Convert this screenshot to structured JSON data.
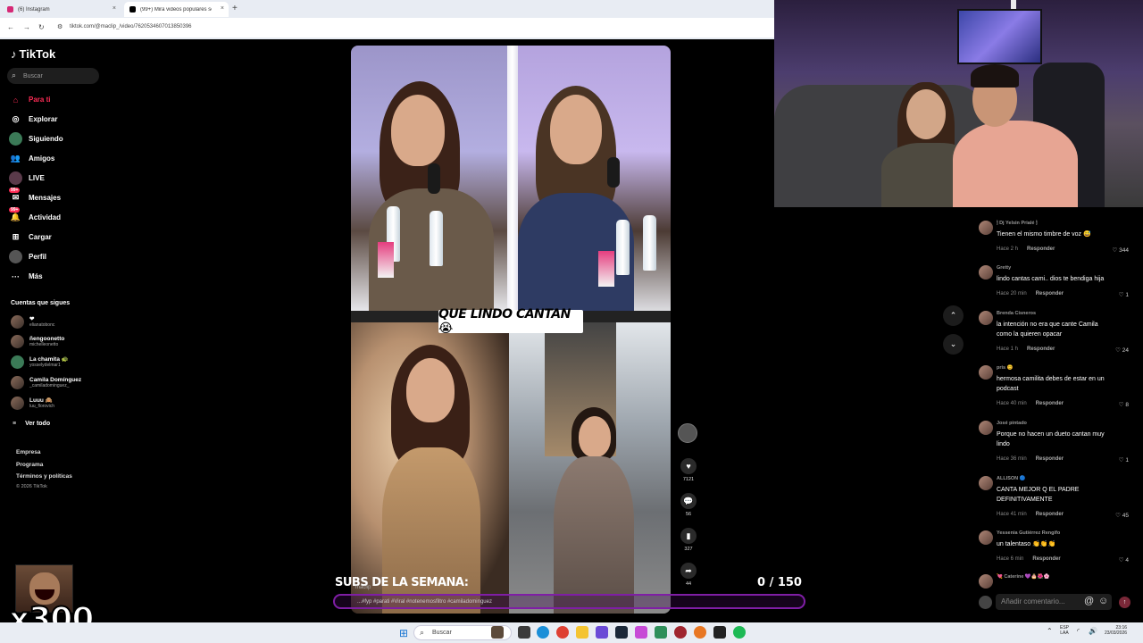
{
  "browser": {
    "tabs": [
      {
        "title": "(6) Instagram",
        "close": "×"
      },
      {
        "title": "(99+) Mira videos populares sob",
        "close": "×"
      }
    ],
    "new_tab": "+",
    "url": "tiktok.com/@maclip_/video/7620534607013850396",
    "back": "←",
    "forward": "→",
    "reload": "↻"
  },
  "tiktok": {
    "logo": "TikTok",
    "search_placeholder": "Buscar",
    "nav": [
      "Para ti",
      "Explorar",
      "Siguiendo",
      "Amigos",
      "LIVE",
      "Mensajes",
      "Actividad",
      "Cargar",
      "Perfil",
      "Más"
    ],
    "badges": {
      "messages": "99+",
      "activity": "99+"
    },
    "following_title": "Cuentas que sigues",
    "following": [
      {
        "name": "❤",
        "handle": "elianatobonc"
      },
      {
        "name": "ñengoonetto",
        "handle": "michelleonetto"
      },
      {
        "name": "La chamita 🐢",
        "handle": "yosselydelmar1"
      },
      {
        "name": "Camila Domínguez",
        "handle": "_camiladominguez_"
      },
      {
        "name": "Luuu 🙈",
        "handle": "luu_florovich"
      }
    ],
    "see_all": "Ver todo",
    "footer": [
      "Empresa",
      "Programa",
      "Términos y políticas"
    ],
    "copyright": "© 2026 TikTok"
  },
  "video": {
    "caption": "QUE LINDO CANTAN😭",
    "likes": "7121",
    "comments": "56",
    "saves": "327",
    "shares": "44",
    "handle": "maclip",
    "description": "...#fyp #parati #Viral #notenemosfiltro #camiladominguez"
  },
  "overlay": {
    "subs_label": "SUBS DE LA SEMANA:",
    "subs_count": "0  / 150",
    "multiplier": "x300"
  },
  "comments": [
    {
      "user": "🕯 Dj Yelsin Prialé 🕯",
      "text": "Tienen el mismo timbre de voz 😅",
      "time": "Hace 2 h",
      "likes": "344"
    },
    {
      "user": "Gretty",
      "text": "lindo cantas cami.. dios te bendiga hija",
      "time": "Hace 20 min",
      "likes": "1"
    },
    {
      "user": "Brenda Cisneros",
      "text": "la intención no era que cante Camila como la quieren opacar",
      "time": "Hace 1 h",
      "likes": "24"
    },
    {
      "user": "pris 😊",
      "text": "hermosa camilita debes de estar en un podcast",
      "time": "Hace 40 min",
      "likes": "8"
    },
    {
      "user": "José pintado",
      "text": "Porque no hacen un dueto cantan muy lindo",
      "time": "Hace 36 min",
      "likes": "1"
    },
    {
      "user": "ALLISON 🔵",
      "text": "CANTA MEJOR Q EL PADRE DEFINITIVAMENTE",
      "time": "Hace 41 min",
      "likes": "45"
    },
    {
      "user": "Yessenia Gutiérrez Rengifo",
      "text": "un talentaso 👏👏👏",
      "time": "Hace 6 min",
      "likes": "4"
    },
    {
      "user": "💘 Caterine 💜🎂🌺🌸",
      "text": "",
      "time": "",
      "likes": ""
    }
  ],
  "reply_label": "Responder",
  "comment_placeholder": "Añadir comentario...",
  "taskbar": {
    "search": "Buscar",
    "lang": [
      "ESP",
      "LAA"
    ],
    "time": "23:16",
    "date": "23/03/2026"
  },
  "colors": {
    "accent": "#fe2c55",
    "subs_border": "#7f1ea5",
    "taskbar": "#e9edf3"
  }
}
